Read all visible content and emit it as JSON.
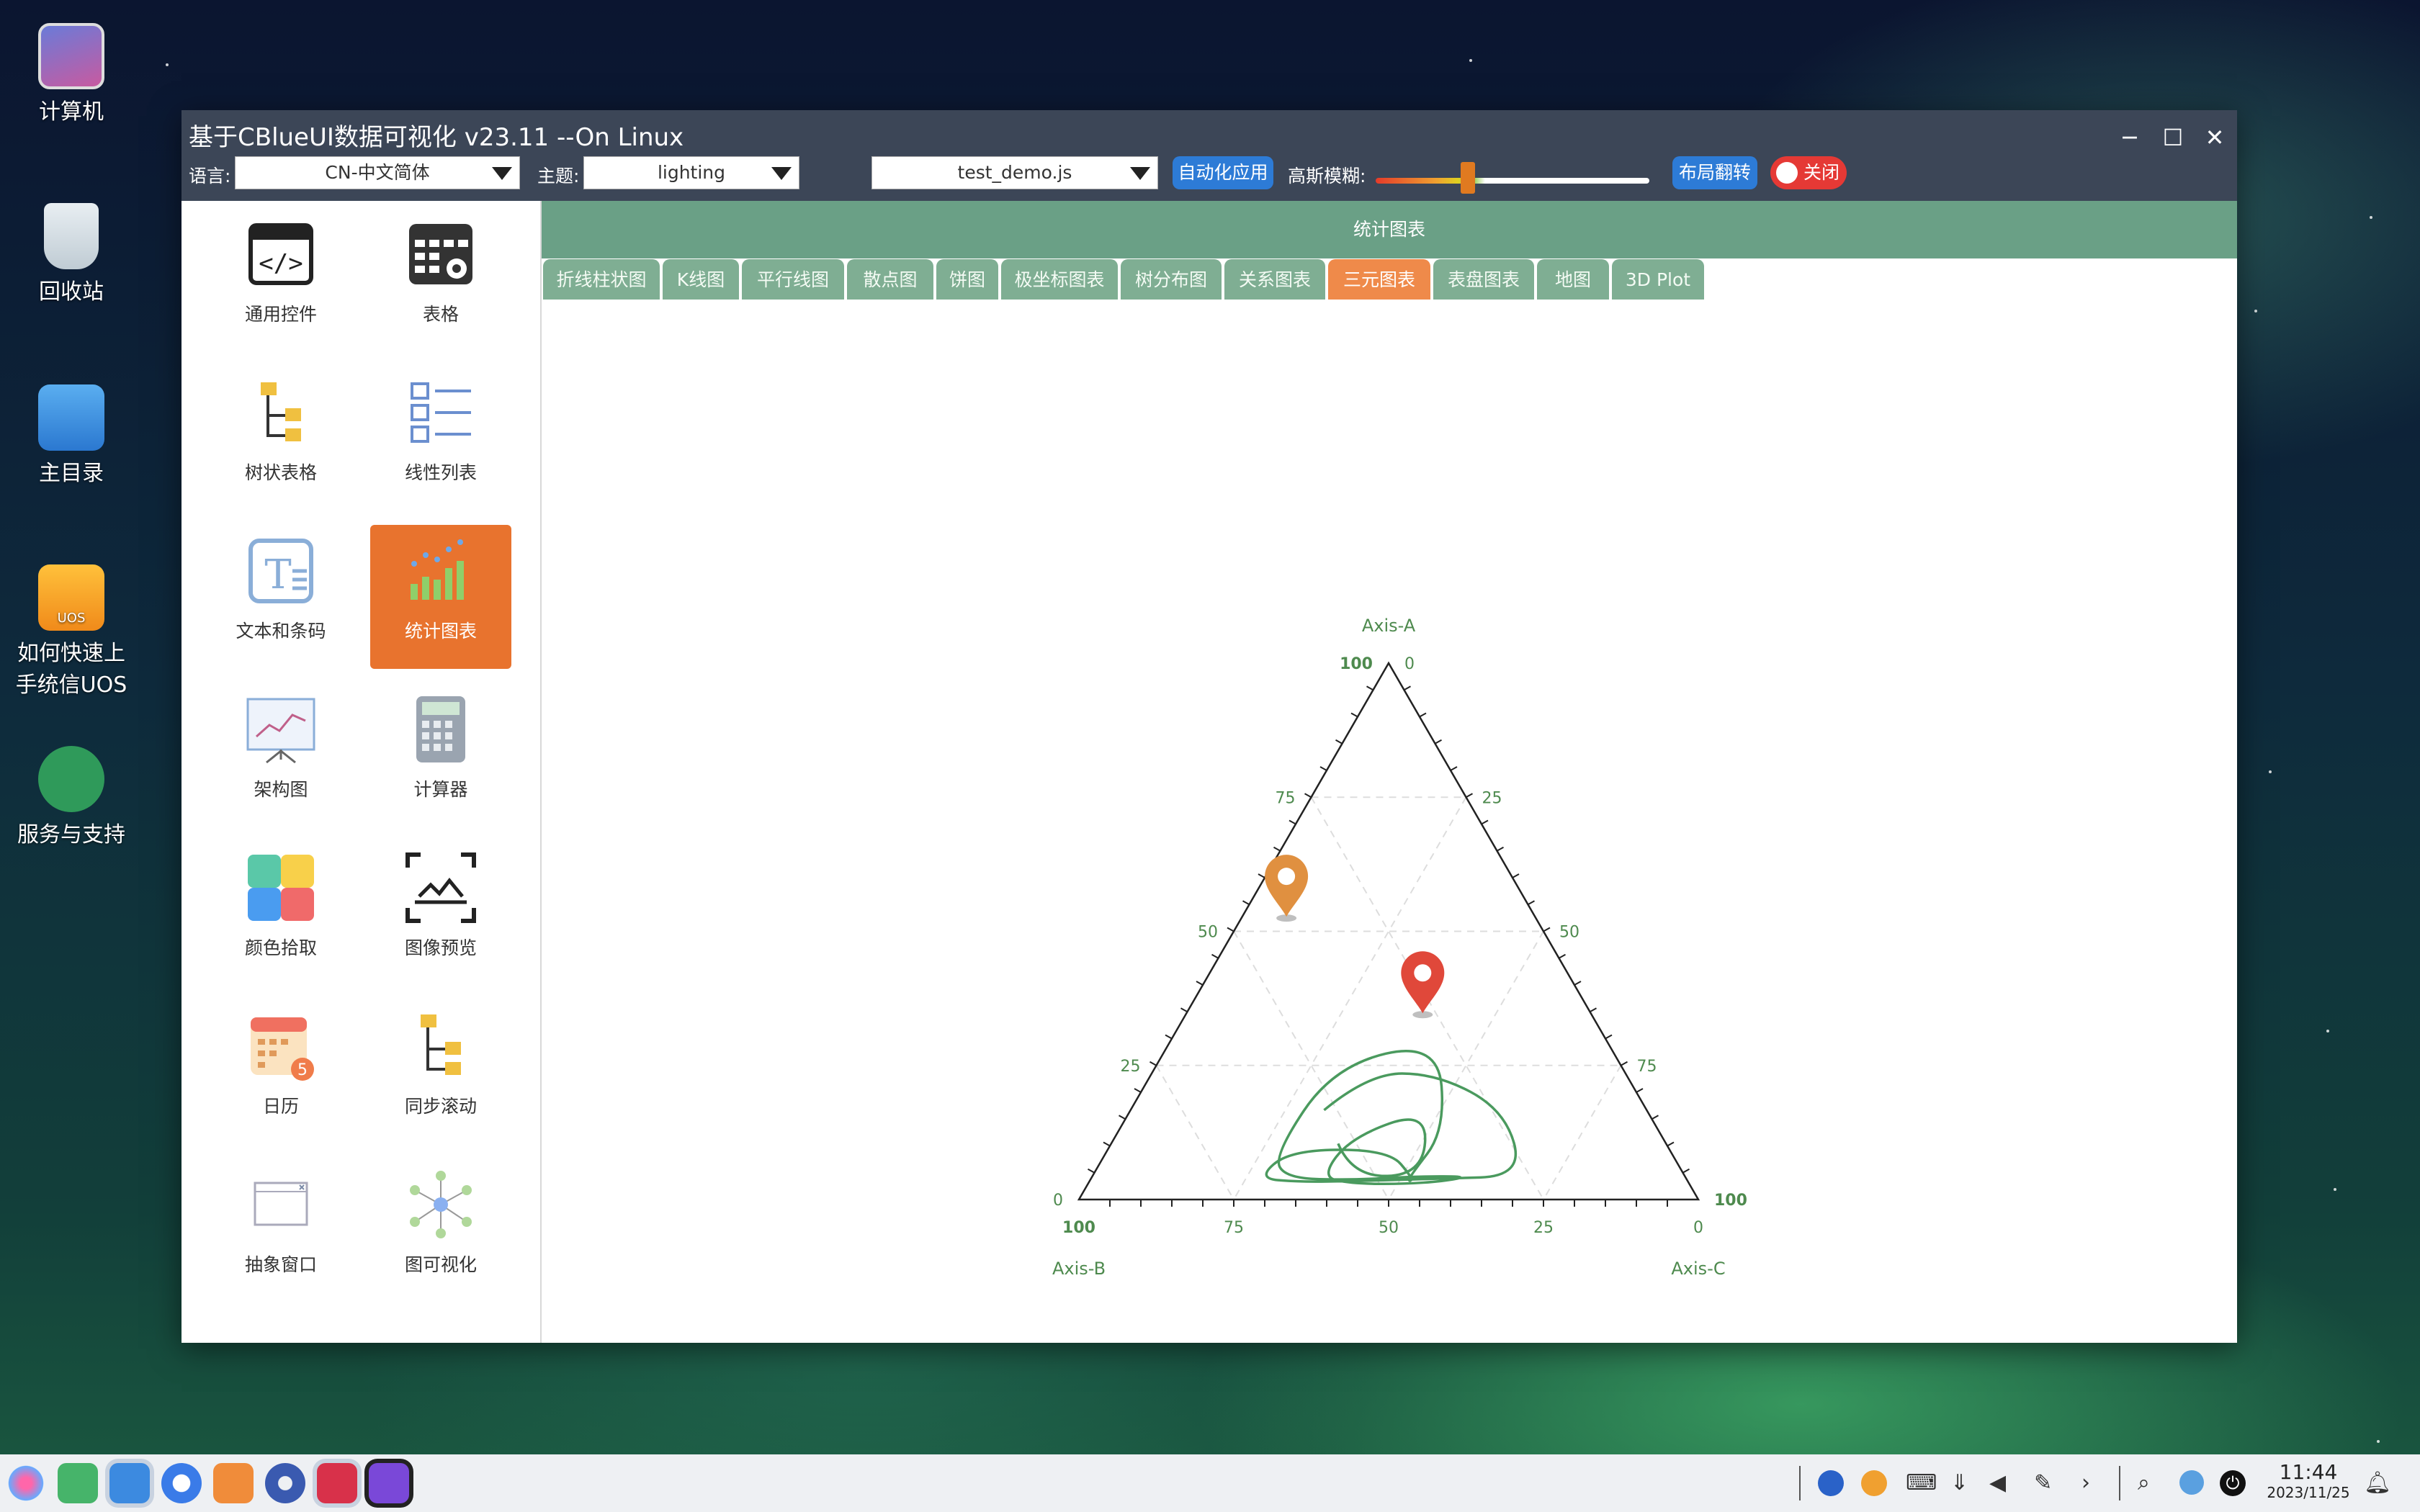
{
  "desktop": {
    "icons": [
      {
        "label": "计算机",
        "icon": "computer-icon"
      },
      {
        "label": "回收站",
        "icon": "trash-icon"
      },
      {
        "label": "主目录",
        "icon": "home-folder-icon"
      },
      {
        "label": "如何快速上手统信UOS",
        "icon": "uos-guide-icon",
        "badge": "UOS"
      },
      {
        "label": "服务与支持",
        "icon": "support-icon"
      }
    ]
  },
  "window": {
    "title": "基于CBlueUI数据可视化 v23.11 --On Linux",
    "controls": {
      "minimize": "─",
      "maximize": "☐",
      "close": "✕"
    }
  },
  "toolbar": {
    "language_label": "语言:",
    "language_value": "CN-中文简体",
    "theme_label": "主题:",
    "theme_value": "lighting",
    "script_value": "test_demo.js",
    "auto_apply_label": "自动化应用",
    "blur_label": "高斯模糊:",
    "blur_level": 0.33,
    "layout_flip_label": "布局翻转",
    "toggle_label": "关闭"
  },
  "sidebar": {
    "items": [
      {
        "label": "通用控件",
        "icon": "code-window-icon"
      },
      {
        "label": "表格",
        "icon": "table-gear-icon"
      },
      {
        "label": "树状表格",
        "icon": "tree-table-icon"
      },
      {
        "label": "线性列表",
        "icon": "linear-list-icon"
      },
      {
        "label": "文本和条码",
        "icon": "text-icon"
      },
      {
        "label": "统计图表",
        "icon": "bar-chart-icon",
        "active": true
      },
      {
        "label": "架构图",
        "icon": "presentation-board-icon"
      },
      {
        "label": "计算器",
        "icon": "calculator-icon"
      },
      {
        "label": "颜色拾取",
        "icon": "color-palette-icon"
      },
      {
        "label": "图像预览",
        "icon": "image-preview-icon"
      },
      {
        "label": "日历",
        "icon": "calendar-icon",
        "badge": "5"
      },
      {
        "label": "同步滚动",
        "icon": "sync-scroll-icon"
      },
      {
        "label": "抽象窗口",
        "icon": "abstract-window-icon"
      },
      {
        "label": "图可视化",
        "icon": "graph-network-icon"
      }
    ]
  },
  "main": {
    "header": "统计图表",
    "tabs": [
      {
        "label": "折线柱状图"
      },
      {
        "label": "K线图"
      },
      {
        "label": "平行线图"
      },
      {
        "label": "散点图"
      },
      {
        "label": "饼图"
      },
      {
        "label": "极坐标图表"
      },
      {
        "label": "树分布图"
      },
      {
        "label": "关系图表"
      },
      {
        "label": "三元图表",
        "active": true
      },
      {
        "label": "表盘图表"
      },
      {
        "label": "地图"
      },
      {
        "label": "3D Plot"
      }
    ]
  },
  "chart_data": {
    "type": "ternary",
    "axes": [
      {
        "name": "Axis-A",
        "ticks": [
          "0",
          "25",
          "50",
          "75",
          "100"
        ]
      },
      {
        "name": "Axis-B",
        "ticks": [
          "0",
          "25",
          "50",
          "75",
          "100"
        ]
      },
      {
        "name": "Axis-C",
        "ticks": [
          "0",
          "25",
          "50",
          "75",
          "100"
        ]
      }
    ],
    "grid": true,
    "markers": [
      {
        "a": 53,
        "b": 40,
        "c": 7,
        "color": "#e09040"
      },
      {
        "a": 35,
        "b": 27,
        "c": 38,
        "color": "#e0483a"
      }
    ],
    "curve_color": "#4a9a5e",
    "curve_points_bc": [
      [
        50,
        30
      ],
      [
        38,
        32
      ],
      [
        28,
        42
      ],
      [
        22,
        58
      ],
      [
        30,
        80
      ],
      [
        52,
        72
      ],
      [
        78,
        62
      ],
      [
        96,
        52
      ],
      [
        88,
        34
      ],
      [
        62,
        30
      ],
      [
        46,
        46
      ],
      [
        56,
        66
      ],
      [
        68,
        78
      ],
      [
        54,
        62
      ],
      [
        34,
        52
      ],
      [
        24,
        38
      ],
      [
        42,
        26
      ],
      [
        66,
        28
      ],
      [
        82,
        40
      ],
      [
        74,
        58
      ],
      [
        52,
        60
      ],
      [
        40,
        70
      ],
      [
        58,
        84
      ],
      [
        80,
        88
      ],
      [
        92,
        72
      ],
      [
        70,
        44
      ],
      [
        50,
        38
      ],
      [
        34,
        46
      ],
      [
        46,
        58
      ],
      [
        64,
        50
      ],
      [
        50,
        30
      ]
    ]
  },
  "taskbar": {
    "apps": [
      "launcher-icon",
      "file-manager-icon",
      "app-store-icon",
      "browser-icon",
      "store-icon",
      "settings-icon",
      "terminal-icon",
      "viewer-icon"
    ],
    "tray": [
      "uos-id-icon",
      "u-icon",
      "keyboard-icon",
      "usb-icon",
      "volume-mute-icon",
      "pen-icon",
      "chevron-right-icon",
      "search-icon",
      "network-icon",
      "power-icon"
    ],
    "time": "11:44",
    "date": "2023/11/25"
  }
}
